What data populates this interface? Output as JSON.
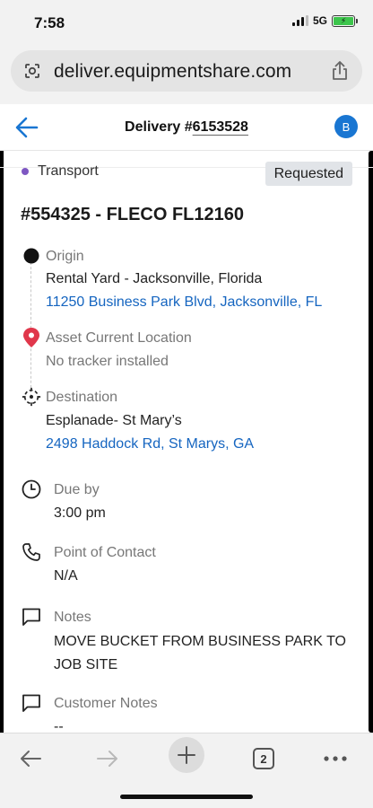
{
  "status_bar": {
    "time": "7:58",
    "network": "5G",
    "battery_charging": true
  },
  "browser": {
    "url": "deliver.equipmentshare.com"
  },
  "header": {
    "title_prefix": "Delivery #",
    "delivery_number": "6153528",
    "avatar_initial": "B"
  },
  "delivery": {
    "type_label": "Transport",
    "status_badge": "Requested",
    "asset_title": "#554325 - FLECO FL12160",
    "origin": {
      "label": "Origin",
      "name": "Rental Yard - Jacksonville, Florida",
      "address": "11250 Business Park Blvd, Jacksonville, FL"
    },
    "current_location": {
      "label": "Asset Current Location",
      "value": "No tracker installed"
    },
    "destination": {
      "label": "Destination",
      "name": "Esplanade- St Mary’s",
      "address": "2498 Haddock Rd, St Marys, GA"
    },
    "due_by": {
      "label": "Due by",
      "value": "3:00 pm"
    },
    "point_of_contact": {
      "label": "Point of Contact",
      "value": "N/A"
    },
    "notes": {
      "label": "Notes",
      "value": "MOVE BUCKET FROM BUSINESS PARK TO JOB SITE"
    },
    "customer_notes": {
      "label": "Customer Notes",
      "value": "--"
    }
  },
  "toolbar": {
    "tab_count": "2"
  },
  "colors": {
    "accent_blue": "#1976d2",
    "link_blue": "#1565c0",
    "transport_dot": "#7e57c2",
    "location_pin": "#e0374b",
    "badge_bg": "#e1e4e8"
  },
  "icons": {
    "back": "arrow-left-icon",
    "origin": "filled-circle-icon",
    "current_location": "map-pin-icon",
    "destination": "crosshair-icon",
    "due_by": "clock-icon",
    "point_of_contact": "phone-icon",
    "notes": "comment-icon",
    "customer_notes": "comment-icon"
  }
}
